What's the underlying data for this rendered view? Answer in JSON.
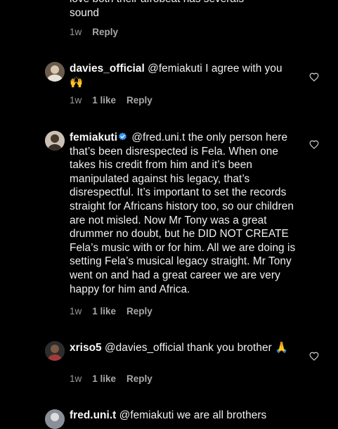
{
  "comments": [
    {
      "partial": true,
      "text_line1": "love both their afrobeat has severals",
      "text_line2": "sound",
      "time": "1w",
      "reply": "Reply"
    },
    {
      "username": "davies_official",
      "text": "@femiakuti I agree with you 🙌",
      "time": "1w",
      "likes": "1 like",
      "reply": "Reply"
    },
    {
      "username": "femiakuti",
      "verified": true,
      "text": "@fred.uni.t the only person here that’s been disrespected is Fela. When one takes his credit from him and it’s been manipulated against his legacy, that’s disrespectful. It’s important to set the records straight for Africans history too, so our children are not misled. Now Mr Tony was a great drummer no doubt, but he DID NOT CREATE Fela’s music with or for him. All we are doing is setting Fela’s musical legacy straight. Mr Tony went on and had a great career we are very happy for him and Africa.",
      "time": "1w",
      "likes": "1 like",
      "reply": "Reply"
    },
    {
      "username": "xriso5",
      "text": "@davies_official thank you brother 🙏",
      "time": "1w",
      "likes": "1 like",
      "reply": "Reply"
    },
    {
      "username": "fred.uni.t",
      "text": "@femiakuti we are all brothers"
    }
  ],
  "colors": {
    "background": "#000000",
    "text": "#f0f0f0",
    "meta": "#9a9a9a",
    "verified": "#3897f0"
  },
  "icons": {
    "like": "heart-outline-icon",
    "verified": "verified-badge-icon"
  }
}
